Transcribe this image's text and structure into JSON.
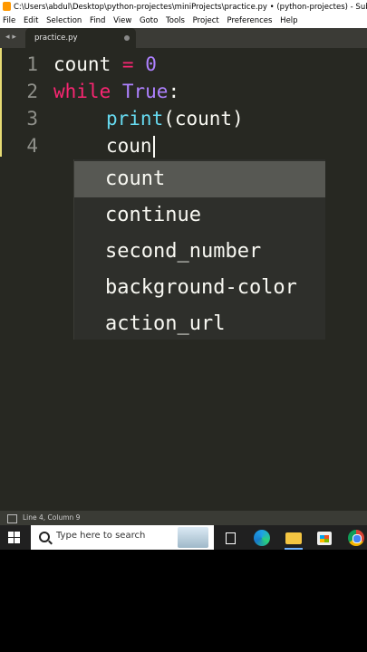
{
  "window": {
    "title": "C:\\Users\\abdul\\Desktop\\python-projectes\\miniProjects\\practice.py • (python-projectes) - Sublime Text (U"
  },
  "menu": [
    "File",
    "Edit",
    "Selection",
    "Find",
    "View",
    "Goto",
    "Tools",
    "Project",
    "Preferences",
    "Help"
  ],
  "tab": {
    "label": "practice.py",
    "nav": "◂ ▸"
  },
  "editor": {
    "lines": [
      {
        "number": "1"
      },
      {
        "number": "2"
      },
      {
        "number": "3"
      },
      {
        "number": "4"
      }
    ],
    "code": {
      "l1_var": "count",
      "l1_op": "=",
      "l1_num": "0",
      "l2_kw": "while",
      "l2_val": "True",
      "l2_colon": ":",
      "l3_func": "print",
      "l3_args": "(count)",
      "l4_text": "coun"
    }
  },
  "autocomplete": {
    "items": [
      "count",
      "continue",
      "second_number",
      "background-color",
      "action_url"
    ],
    "selected_index": 0
  },
  "statusbar": {
    "position": "Line 4, Column 9"
  },
  "taskbar": {
    "search_placeholder": "Type here to search",
    "icons": [
      "windows-start-icon",
      "search-icon",
      "task-view-icon",
      "edge-icon",
      "file-explorer-icon",
      "store-icon",
      "chrome-icon"
    ]
  },
  "colors": {
    "editor_bg": "#272822",
    "keyword": "#f92672",
    "number": "#ae81ff",
    "builtin": "#66d9ef",
    "text": "#f8f8f2",
    "selection": "#575853"
  }
}
